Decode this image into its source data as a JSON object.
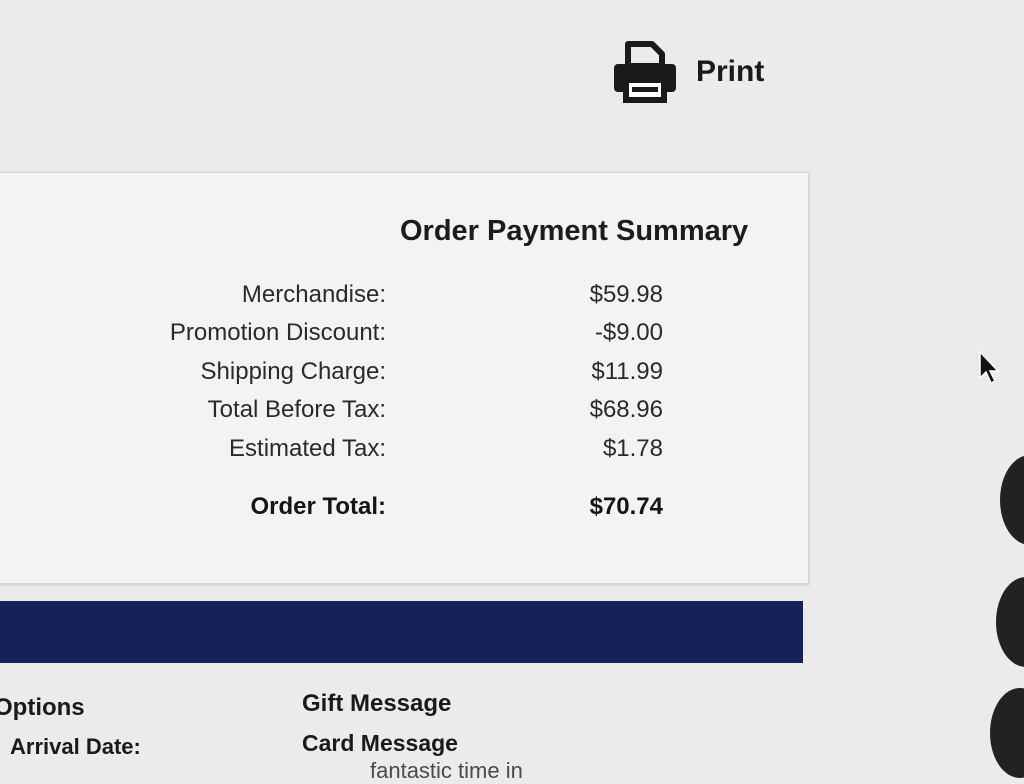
{
  "toolbar": {
    "print_label": "Print",
    "print_icon": "printer-icon"
  },
  "summary": {
    "title": "Order Payment Summary",
    "rows": [
      {
        "label": "Merchandise:",
        "value": "$59.98"
      },
      {
        "label": "Promotion Discount:",
        "value": "-$9.00"
      },
      {
        "label": "Shipping Charge:",
        "value": "$11.99"
      },
      {
        "label": "Total Before Tax:",
        "value": "$68.96"
      },
      {
        "label": "Estimated Tax:",
        "value": "$1.78"
      }
    ],
    "total": {
      "label": "Order Total:",
      "value": "$70.74"
    }
  },
  "bottom": {
    "options_heading": "Options",
    "arrival_label": "Arrival Date:",
    "gift_heading": "Gift Message",
    "card_heading": "Card Message",
    "card_text_fragment": "fantastic time in"
  },
  "colors": {
    "banner": "#14215a",
    "panel": "#f3f3f1",
    "page": "#ebebeb"
  }
}
